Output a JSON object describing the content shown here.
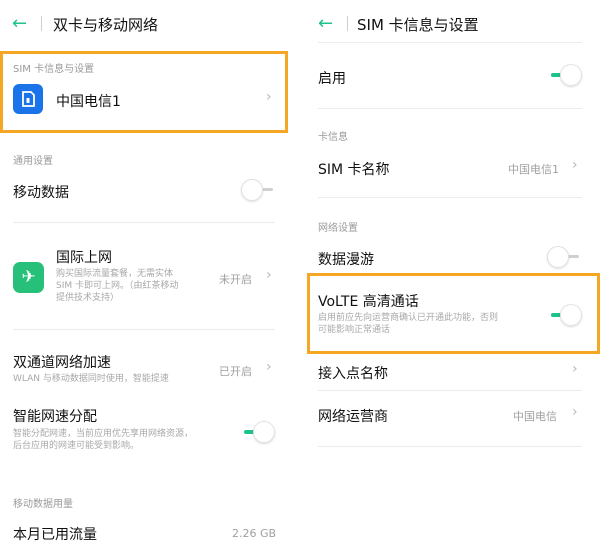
{
  "colors": {
    "accent": "#1ec38a",
    "highlight": "#f5a623",
    "sim_icon": "#1a73e8",
    "plane_icon": "#27c07a"
  },
  "left": {
    "title": "双卡与移动网络",
    "sim_section": "SIM 卡信息与设置",
    "sim_name": "中国电信1",
    "general_section": "通用设置",
    "mobile_data": {
      "label": "移动数据",
      "state": "off"
    },
    "intl": {
      "label": "国际上网",
      "desc": [
        "购买国际流量套餐，无需实体",
        "SIM 卡即可上网。（由红茶移动",
        "提供技术支持）"
      ],
      "value": "未开启"
    },
    "dual_channel": {
      "label": "双通道网络加速",
      "desc": "WLAN 与移动数据同时使用，智能提速",
      "value": "已开启"
    },
    "smart_speed": {
      "label": "智能网速分配",
      "desc": [
        "智能分配网速，当前应用优先享用网络资源，",
        "后台应用的网速可能受到影响。"
      ],
      "state": "on"
    },
    "usage_section": "移动数据用量",
    "monthly": {
      "label": "本月已用流量",
      "value": "2.26 GB"
    }
  },
  "right": {
    "title": "SIM 卡信息与设置",
    "enable": {
      "label": "启用",
      "state": "on"
    },
    "card_section": "卡信息",
    "sim_name": {
      "label": "SIM 卡名称",
      "value": "中国电信1"
    },
    "network_section": "网络设置",
    "roaming": {
      "label": "数据漫游",
      "state": "off"
    },
    "volte": {
      "label": "VoLTE 高清通话",
      "desc": [
        "启用前应先向运营商确认已开通此功能，否则",
        "可能影响正常通话"
      ],
      "state": "on"
    },
    "apn": {
      "label": "接入点名称"
    },
    "operator": {
      "label": "网络运营商",
      "value": "中国电信"
    }
  },
  "icons": {
    "back": "←",
    "chevron": "›",
    "plane": "✈"
  }
}
